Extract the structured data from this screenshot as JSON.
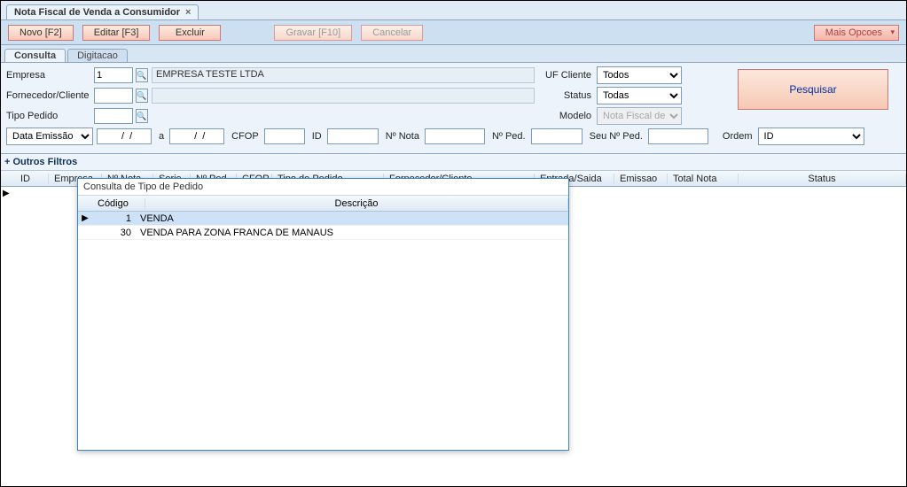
{
  "title": "Nota Fiscal de Venda a Consumidor",
  "toolbar": {
    "novo": "Novo [F2]",
    "editar": "Editar [F3]",
    "excluir": "Excluir",
    "gravar": "Gravar [F10]",
    "cancelar": "Cancelar",
    "mais": "Mais Opcoes"
  },
  "subtabs": {
    "consulta": "Consulta",
    "digitacao": "Digitacao"
  },
  "form": {
    "empresa_label": "Empresa",
    "empresa_value": "1",
    "empresa_nome": "EMPRESA TESTE LTDA",
    "uf_label": "UF Cliente",
    "uf_value": "Todos",
    "fornecedor_label": "Fornecedor/Cliente",
    "fornecedor_value": "",
    "fornecedor_nome": "",
    "status_label": "Status",
    "status_value": "Todas",
    "tipo_label": "Tipo Pedido",
    "tipo_value": "",
    "modelo_label": "Modelo",
    "modelo_value": "Nota Fiscal de V",
    "pesquisar": "Pesquisar",
    "data_combo": "Data Emissão",
    "data_de": "  /  /",
    "a_label": "a",
    "data_ate": "  /  /",
    "cfop_label": "CFOP",
    "cfop_value": "",
    "id_label": "ID",
    "id_value": "",
    "nonota_label": "Nº Nota",
    "nonota_value": "",
    "noped_label": "Nº Ped.",
    "noped_value": "",
    "seunoped_label": "Seu Nº Ped.",
    "seunoped_value": "",
    "ordem_label": "Ordem",
    "ordem_value": "ID"
  },
  "outros": "+ Outros Filtros",
  "grid_cols": {
    "id": "ID",
    "empresa": "Empresa",
    "nonota": "Nº Nota",
    "serie": "Serie",
    "noped": "Nº Ped.",
    "cfop": "CFOP",
    "tipopedido": "Tipo de Pedido",
    "fornecedor": "Fornecedor/Cliente",
    "entradasaida": "Entrada/Saida",
    "emissao": "Emissao",
    "totalnota": "Total Nota",
    "status": "Status"
  },
  "popup": {
    "title": "Consulta de Tipo de Pedido",
    "col_codigo": "Código",
    "col_desc": "Descrição",
    "rows": [
      {
        "codigo": "1",
        "descricao": "VENDA",
        "selected": true
      },
      {
        "codigo": "30",
        "descricao": "VENDA PARA ZONA FRANCA DE MANAUS",
        "selected": false
      }
    ]
  }
}
